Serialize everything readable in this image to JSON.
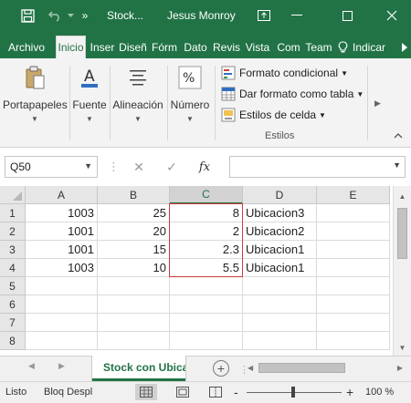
{
  "titlebar": {
    "doc_title": "Stock...",
    "user_name": "Jesus Monroy",
    "autosave_hint": "»"
  },
  "ribbon_tabs": [
    "Archivo",
    "Inicio",
    "Inser",
    "Diseñ",
    "Fórm",
    "Dato",
    "Revis",
    "Vista",
    "Com",
    "Team",
    "Indicar"
  ],
  "ribbon": {
    "groups": {
      "clipboard": "Portapapeles",
      "font": "Fuente",
      "alignment": "Alineación",
      "number": "Número"
    },
    "styles": {
      "conditional": "Formato condicional",
      "as_table": "Dar formato como tabla",
      "cell_styles": "Estilos de celda",
      "caption": "Estilos"
    }
  },
  "formula_bar": {
    "name_box": "Q50",
    "formula": "",
    "fx_label": "fx"
  },
  "grid": {
    "columns": [
      "A",
      "B",
      "C",
      "D",
      "E"
    ],
    "rows": [
      "1",
      "2",
      "3",
      "4",
      "5",
      "6",
      "7",
      "8"
    ],
    "cells": [
      [
        "1003",
        "25",
        "8",
        "Ubicacion3",
        ""
      ],
      [
        "1001",
        "20",
        "2",
        "Ubicacion2",
        ""
      ],
      [
        "1001",
        "15",
        "2.3",
        "Ubicacion1",
        ""
      ],
      [
        "1003",
        "10",
        "5.5",
        "Ubicacion1",
        ""
      ],
      [
        "",
        "",
        "",
        "",
        ""
      ],
      [
        "",
        "",
        "",
        "",
        ""
      ],
      [
        "",
        "",
        "",
        "",
        ""
      ],
      [
        "",
        "",
        "",
        "",
        ""
      ]
    ]
  },
  "sheets": {
    "active": "Stock con Ubicacion",
    "add_label": "+"
  },
  "statusbar": {
    "ready": "Listo",
    "scroll_lock": "Bloq Despl",
    "zoom_minus": "-",
    "zoom_plus": "+",
    "zoom": "100 %"
  },
  "colors": {
    "accent": "#217346",
    "highlight_border": "#d13b3b"
  }
}
